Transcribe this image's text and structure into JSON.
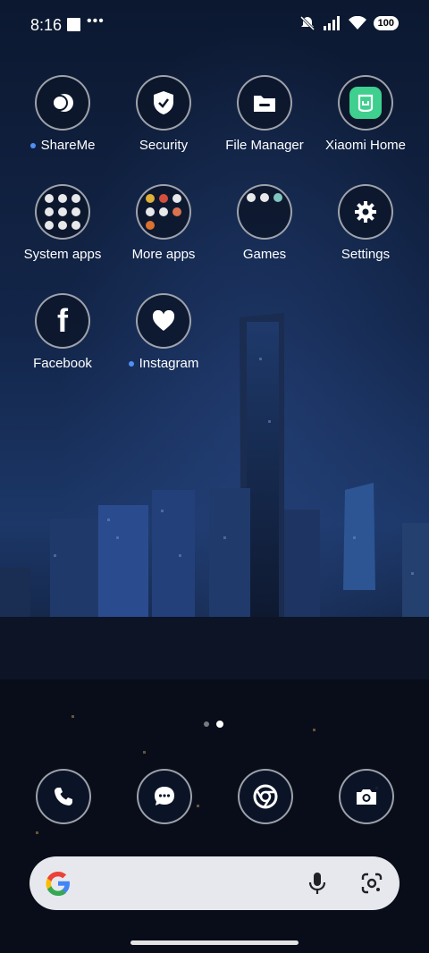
{
  "status_bar": {
    "time": "8:16",
    "dots": "•••",
    "battery": "100"
  },
  "apps": [
    {
      "label": "ShareMe",
      "new": true,
      "icon": "shareme-icon"
    },
    {
      "label": "Security",
      "new": false,
      "icon": "shield-icon"
    },
    {
      "label": "File Manager",
      "new": false,
      "icon": "folder-icon"
    },
    {
      "label": "Xiaomi Home",
      "new": false,
      "icon": "xiaomi-home-icon"
    },
    {
      "label": "System apps",
      "new": false,
      "icon": "folder-grid-icon"
    },
    {
      "label": "More apps",
      "new": false,
      "icon": "folder-grid-icon"
    },
    {
      "label": "Games",
      "new": false,
      "icon": "folder-grid-icon"
    },
    {
      "label": "Settings",
      "new": false,
      "icon": "gear-icon"
    },
    {
      "label": "Facebook",
      "new": false,
      "icon": "facebook-icon"
    },
    {
      "label": "Instagram",
      "new": true,
      "icon": "heart-icon"
    }
  ],
  "dock": [
    {
      "name": "phone",
      "icon": "phone-icon"
    },
    {
      "name": "messages",
      "icon": "chat-icon"
    },
    {
      "name": "chrome",
      "icon": "chrome-icon"
    },
    {
      "name": "camera",
      "icon": "camera-icon"
    }
  ],
  "search_bar": {
    "logo": "google-g-icon",
    "mic": "mic-icon",
    "lens": "lens-icon"
  },
  "colors": {
    "accent_dot": "#4f8ff7",
    "xiaomi_green": "#3fcf8e"
  }
}
